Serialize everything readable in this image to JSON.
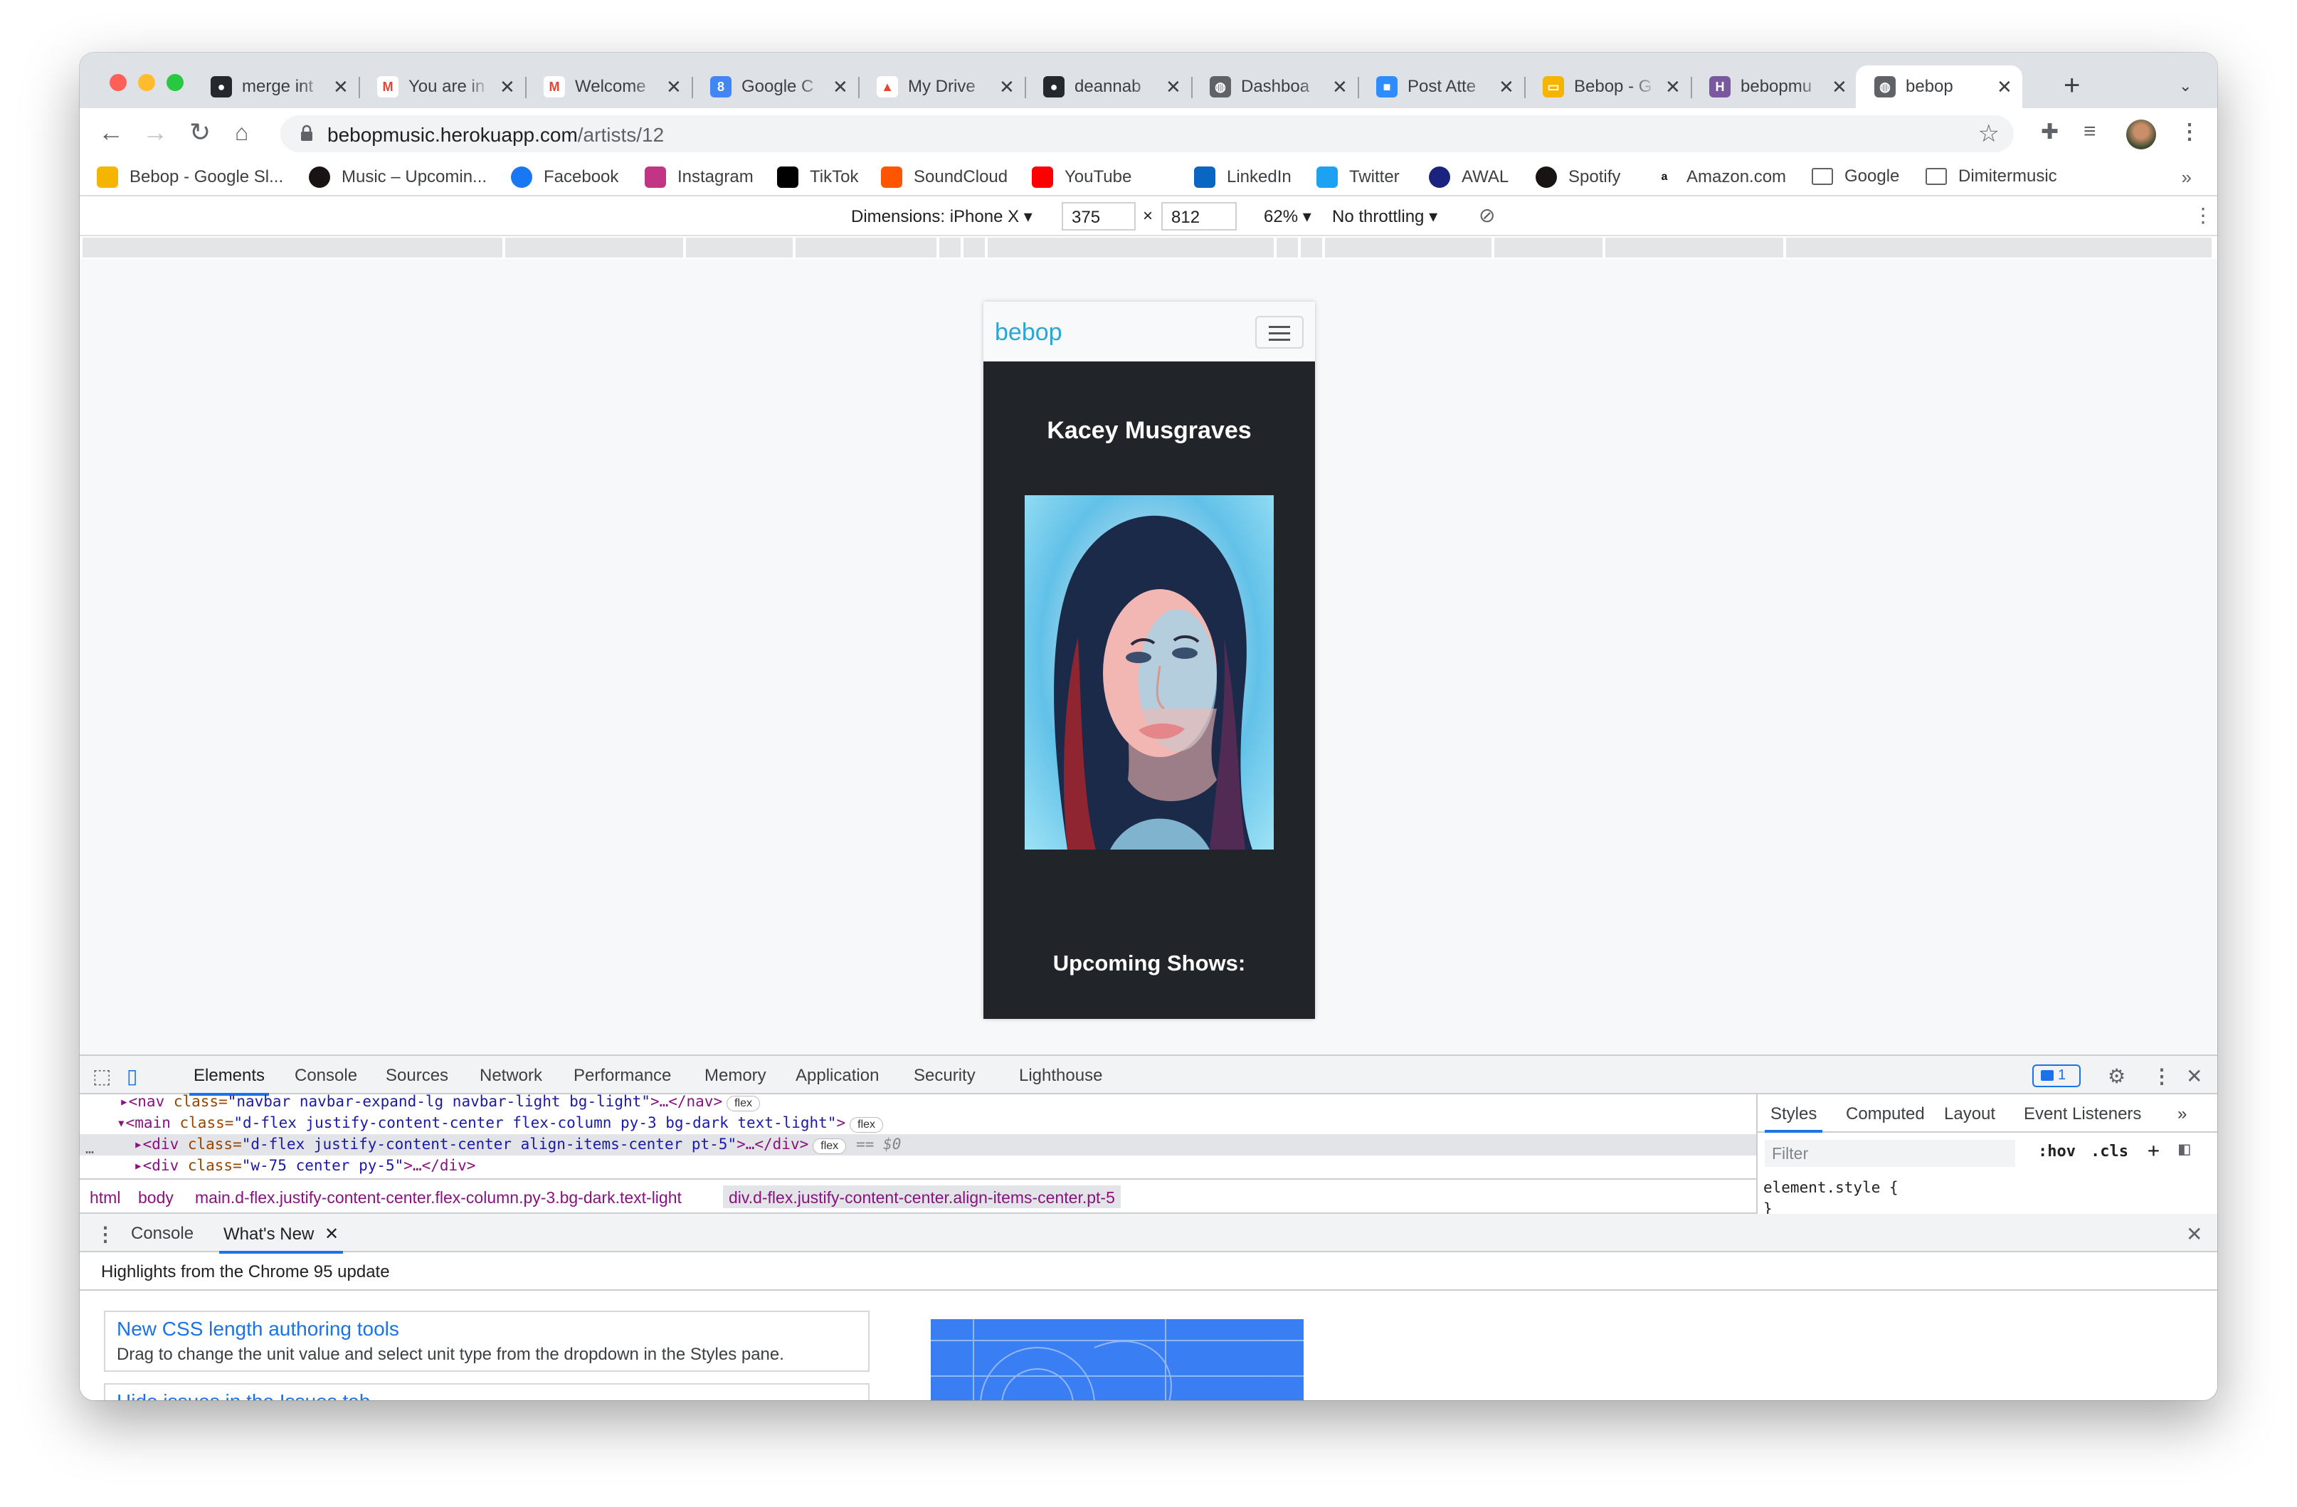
{
  "browser": {
    "tabs": [
      {
        "title": "merge int",
        "icon": "github-icon",
        "color": "#24292e",
        "glyph": "●"
      },
      {
        "title": "You are in",
        "icon": "gmail-icon",
        "color": "#ffffff",
        "glyph": "M"
      },
      {
        "title": "Welcome",
        "icon": "gmail-icon",
        "color": "#ffffff",
        "glyph": "M"
      },
      {
        "title": "Google C",
        "icon": "google-calendar-icon",
        "color": "#4285f4",
        "glyph": "8"
      },
      {
        "title": "My Drive",
        "icon": "google-drive-icon",
        "color": "#ffffff",
        "glyph": "▲"
      },
      {
        "title": "deannab",
        "icon": "github-icon",
        "color": "#24292e",
        "glyph": "●"
      },
      {
        "title": "Dashboa",
        "icon": "globe-icon",
        "color": "#5f6368",
        "glyph": "◍"
      },
      {
        "title": "Post Atte",
        "icon": "zoom-icon",
        "color": "#2d8cff",
        "glyph": "■"
      },
      {
        "title": "Bebop - G",
        "icon": "google-slides-icon",
        "color": "#f4b400",
        "glyph": "▭"
      },
      {
        "title": "bebopmu",
        "icon": "heroku-icon",
        "color": "#79589f",
        "glyph": "H"
      },
      {
        "title": "bebop",
        "icon": "globe-icon",
        "color": "#5f6368",
        "glyph": "◍",
        "active": true
      }
    ],
    "url_host": "bebopmusic.herokuapp.com",
    "url_path": "/artists/12",
    "bookmarks": [
      {
        "label": "Bebop - Google Sl...",
        "icon": "google-slides-icon",
        "color": "#f4b400"
      },
      {
        "label": "Music – Upcomin...",
        "icon": "spotify-icon",
        "color": "#191414"
      },
      {
        "label": "Facebook",
        "icon": "facebook-icon",
        "color": "#1877f2"
      },
      {
        "label": "Instagram",
        "icon": "instagram-icon",
        "color": "#c13584"
      },
      {
        "label": "TikTok",
        "icon": "tiktok-icon",
        "color": "#010101"
      },
      {
        "label": "SoundCloud",
        "icon": "soundcloud-icon",
        "color": "#ff5500"
      },
      {
        "label": "YouTube",
        "icon": "youtube-icon",
        "color": "#ff0000"
      },
      {
        "label": "LinkedIn",
        "icon": "linkedin-icon",
        "color": "#0a66c2"
      },
      {
        "label": "Twitter",
        "icon": "twitter-icon",
        "color": "#1da1f2"
      },
      {
        "label": "AWAL",
        "icon": "awal-icon",
        "color": "#1a237e"
      },
      {
        "label": "Spotify",
        "icon": "spotify-icon",
        "color": "#191414"
      },
      {
        "label": "Amazon.com",
        "icon": "amazon-icon",
        "color": "#ffffff"
      },
      {
        "label": "Google",
        "icon": "folder-icon",
        "color": "#ffffff"
      },
      {
        "label": "Dimitermusic",
        "icon": "folder-icon",
        "color": "#ffffff"
      }
    ],
    "bookmarks_more": "»"
  },
  "device_toolbar": {
    "dimensions_label": "Dimensions: iPhone X ▾",
    "width": "375",
    "times": "×",
    "height": "812",
    "zoom": "62% ▾",
    "throttling": "No throttling ▾"
  },
  "page": {
    "brand": "bebop",
    "artist_name": "Kacey Musgraves",
    "upcoming_heading": "Upcoming Shows:"
  },
  "devtools": {
    "tabs": [
      "Elements",
      "Console",
      "Sources",
      "Network",
      "Performance",
      "Memory",
      "Application",
      "Security",
      "Lighthouse"
    ],
    "issues_count": "1",
    "dom_lines": [
      {
        "pre": "▸<nav ",
        "attr": "class=",
        "val": "\"navbar navbar-expand-lg navbar-light bg-light\"",
        "post": ">…</nav>",
        "pill": "flex"
      },
      {
        "pre": "▾<main ",
        "attr": "class=",
        "val": "\"d-flex justify-content-center flex-column py-3 bg-dark text-light\"",
        "post": ">",
        "pill": "flex"
      },
      {
        "pre": "▸<div ",
        "attr": "class=",
        "val": "\"d-flex justify-content-center align-items-center pt-5\"",
        "post": ">…</div>",
        "pill": "flex",
        "suffix": "== $0"
      },
      {
        "pre": "▸<div ",
        "attr": "class=",
        "val": "\"w-75 center py-5\"",
        "post": ">…</div>",
        "pill": ""
      }
    ],
    "breadcrumbs": [
      "html",
      "body",
      "main.d-flex.justify-content-center.flex-column.py-3.bg-dark.text-light",
      "div.d-flex.justify-content-center.align-items-center.pt-5"
    ],
    "styles_tabs": [
      "Styles",
      "Computed",
      "Layout",
      "Event Listeners",
      "»"
    ],
    "filter_placeholder": "Filter",
    "hov": ":hov",
    "cls": ".cls",
    "element_style": "element.style {",
    "element_style_close": "}",
    "drawer_tabs": [
      "Console",
      "What's New"
    ],
    "whats_new_heading": "Highlights from the Chrome 95 update",
    "cards": [
      {
        "title": "New CSS length authoring tools",
        "desc": "Drag to change the unit value and select unit type from the dropdown in the Styles pane."
      },
      {
        "title": "Hide issues in the Issues tab",
        "desc": ""
      }
    ]
  }
}
